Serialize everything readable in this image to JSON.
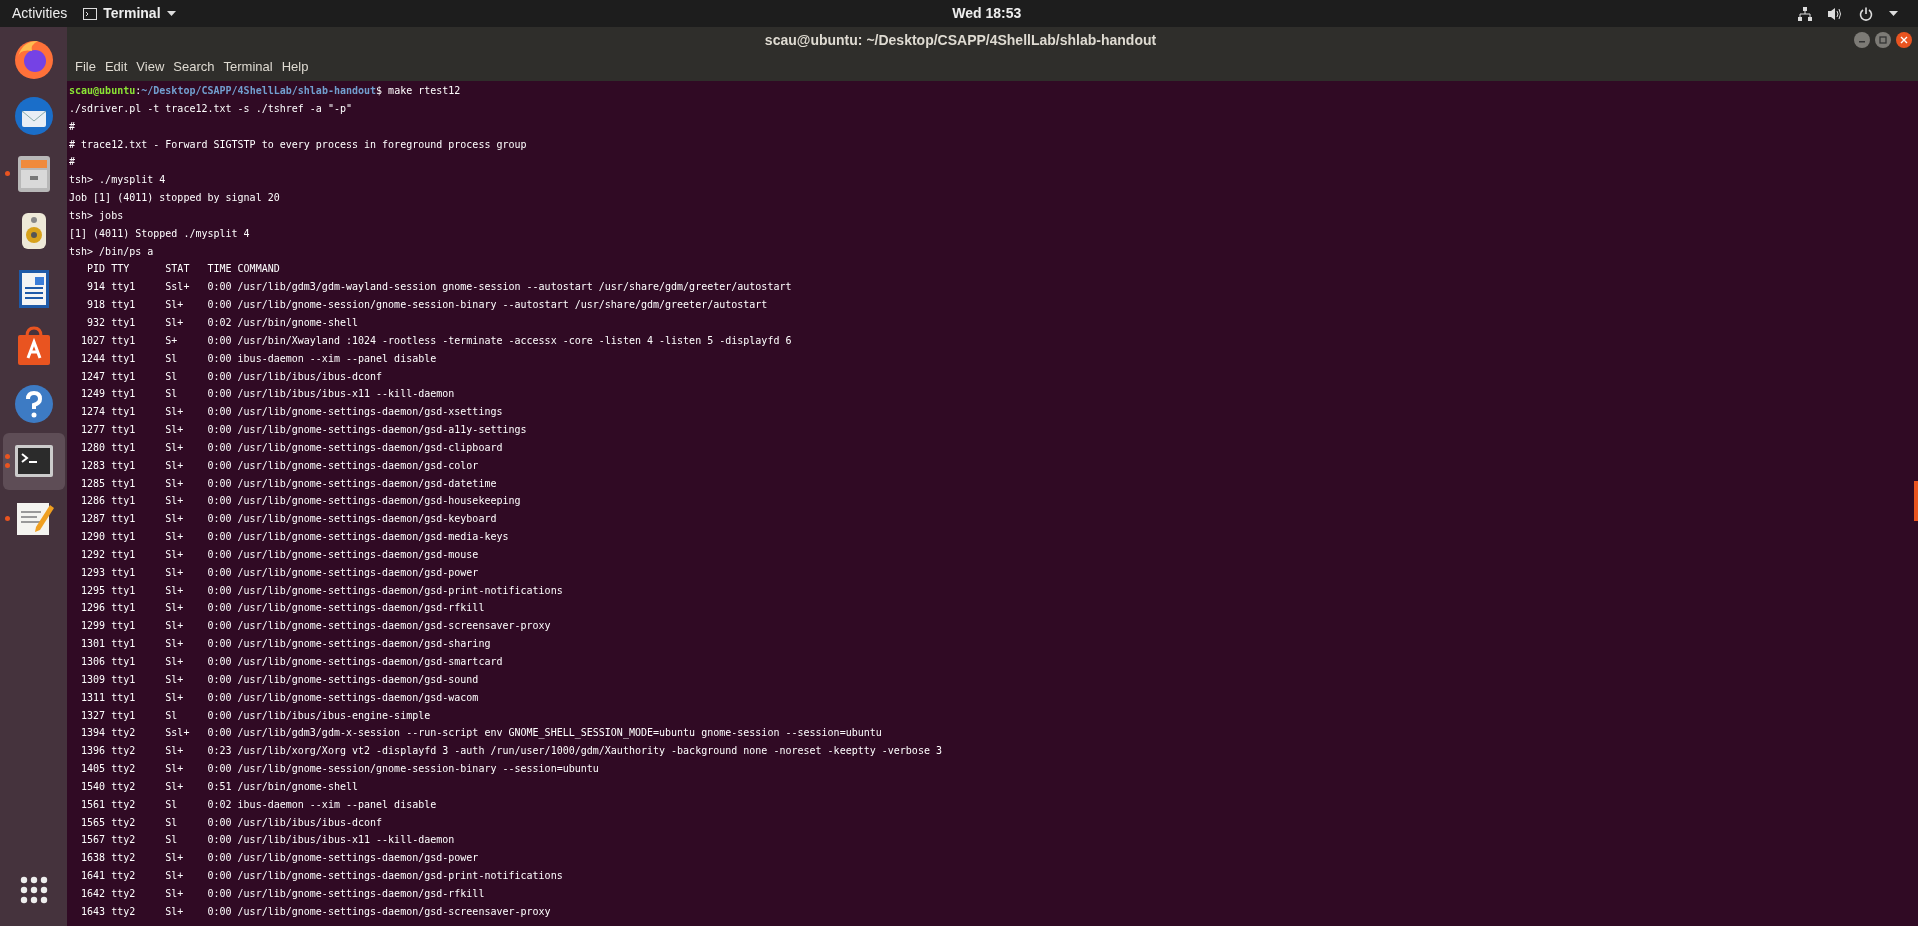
{
  "top_bar": {
    "activities": "Activities",
    "app_menu": "Terminal",
    "clock": "Wed 18:53"
  },
  "dock": {
    "items": [
      {
        "kind": "firefox",
        "running": false,
        "multiple": false,
        "selected": false
      },
      {
        "kind": "thunderbird",
        "running": false,
        "multiple": false,
        "selected": false
      },
      {
        "kind": "files",
        "running": true,
        "multiple": false,
        "selected": false
      },
      {
        "kind": "rhythmbox",
        "running": false,
        "multiple": false,
        "selected": false
      },
      {
        "kind": "writer",
        "running": false,
        "multiple": false,
        "selected": false
      },
      {
        "kind": "software",
        "running": false,
        "multiple": false,
        "selected": false
      },
      {
        "kind": "help",
        "running": false,
        "multiple": false,
        "selected": false
      },
      {
        "kind": "terminal",
        "running": true,
        "multiple": true,
        "selected": true
      },
      {
        "kind": "editor",
        "running": true,
        "multiple": false,
        "selected": false
      }
    ]
  },
  "window": {
    "title": "scau@ubuntu: ~/Desktop/CSAPP/4ShellLab/shlab-handout",
    "menu": [
      "File",
      "Edit",
      "View",
      "Search",
      "Terminal",
      "Help"
    ]
  },
  "terminal": {
    "lines": [
      {
        "kind": "prompt",
        "user_host": "scau@ubuntu",
        "separator": ":",
        "path": "~/Desktop/CSAPP/4ShellLab/shlab-handout",
        "command": "$ make rtest12"
      },
      {
        "kind": "text",
        "text": "./sdriver.pl -t trace12.txt -s ./tshref -a \"-p\""
      },
      {
        "kind": "text",
        "text": "#"
      },
      {
        "kind": "text",
        "text": "# trace12.txt - Forward SIGTSTP to every process in foreground process group"
      },
      {
        "kind": "text",
        "text": "#"
      },
      {
        "kind": "text",
        "text": "tsh> ./mysplit 4"
      },
      {
        "kind": "text",
        "text": "Job [1] (4011) stopped by signal 20"
      },
      {
        "kind": "text",
        "text": "tsh> jobs"
      },
      {
        "kind": "text",
        "text": "[1] (4011) Stopped ./mysplit 4"
      },
      {
        "kind": "text",
        "text": "tsh> /bin/ps a"
      },
      {
        "kind": "text",
        "text": "   PID TTY      STAT   TIME COMMAND"
      },
      {
        "kind": "text",
        "text": "   914 tty1     Ssl+   0:00 /usr/lib/gdm3/gdm-wayland-session gnome-session --autostart /usr/share/gdm/greeter/autostart"
      },
      {
        "kind": "text",
        "text": "   918 tty1     Sl+    0:00 /usr/lib/gnome-session/gnome-session-binary --autostart /usr/share/gdm/greeter/autostart"
      },
      {
        "kind": "text",
        "text": "   932 tty1     Sl+    0:02 /usr/bin/gnome-shell"
      },
      {
        "kind": "text",
        "text": "  1027 tty1     S+     0:00 /usr/bin/Xwayland :1024 -rootless -terminate -accessx -core -listen 4 -listen 5 -displayfd 6"
      },
      {
        "kind": "text",
        "text": "  1244 tty1     Sl     0:00 ibus-daemon --xim --panel disable"
      },
      {
        "kind": "text",
        "text": "  1247 tty1     Sl     0:00 /usr/lib/ibus/ibus-dconf"
      },
      {
        "kind": "text",
        "text": "  1249 tty1     Sl     0:00 /usr/lib/ibus/ibus-x11 --kill-daemon"
      },
      {
        "kind": "text",
        "text": "  1274 tty1     Sl+    0:00 /usr/lib/gnome-settings-daemon/gsd-xsettings"
      },
      {
        "kind": "text",
        "text": "  1277 tty1     Sl+    0:00 /usr/lib/gnome-settings-daemon/gsd-a11y-settings"
      },
      {
        "kind": "text",
        "text": "  1280 tty1     Sl+    0:00 /usr/lib/gnome-settings-daemon/gsd-clipboard"
      },
      {
        "kind": "text",
        "text": "  1283 tty1     Sl+    0:00 /usr/lib/gnome-settings-daemon/gsd-color"
      },
      {
        "kind": "text",
        "text": "  1285 tty1     Sl+    0:00 /usr/lib/gnome-settings-daemon/gsd-datetime"
      },
      {
        "kind": "text",
        "text": "  1286 tty1     Sl+    0:00 /usr/lib/gnome-settings-daemon/gsd-housekeeping"
      },
      {
        "kind": "text",
        "text": "  1287 tty1     Sl+    0:00 /usr/lib/gnome-settings-daemon/gsd-keyboard"
      },
      {
        "kind": "text",
        "text": "  1290 tty1     Sl+    0:00 /usr/lib/gnome-settings-daemon/gsd-media-keys"
      },
      {
        "kind": "text",
        "text": "  1292 tty1     Sl+    0:00 /usr/lib/gnome-settings-daemon/gsd-mouse"
      },
      {
        "kind": "text",
        "text": "  1293 tty1     Sl+    0:00 /usr/lib/gnome-settings-daemon/gsd-power"
      },
      {
        "kind": "text",
        "text": "  1295 tty1     Sl+    0:00 /usr/lib/gnome-settings-daemon/gsd-print-notifications"
      },
      {
        "kind": "text",
        "text": "  1296 tty1     Sl+    0:00 /usr/lib/gnome-settings-daemon/gsd-rfkill"
      },
      {
        "kind": "text",
        "text": "  1299 tty1     Sl+    0:00 /usr/lib/gnome-settings-daemon/gsd-screensaver-proxy"
      },
      {
        "kind": "text",
        "text": "  1301 tty1     Sl+    0:00 /usr/lib/gnome-settings-daemon/gsd-sharing"
      },
      {
        "kind": "text",
        "text": "  1306 tty1     Sl+    0:00 /usr/lib/gnome-settings-daemon/gsd-smartcard"
      },
      {
        "kind": "text",
        "text": "  1309 tty1     Sl+    0:00 /usr/lib/gnome-settings-daemon/gsd-sound"
      },
      {
        "kind": "text",
        "text": "  1311 tty1     Sl+    0:00 /usr/lib/gnome-settings-daemon/gsd-wacom"
      },
      {
        "kind": "text",
        "text": "  1327 tty1     Sl     0:00 /usr/lib/ibus/ibus-engine-simple"
      },
      {
        "kind": "text",
        "text": "  1394 tty2     Ssl+   0:00 /usr/lib/gdm3/gdm-x-session --run-script env GNOME_SHELL_SESSION_MODE=ubuntu gnome-session --session=ubuntu"
      },
      {
        "kind": "text",
        "text": "  1396 tty2     Sl+    0:23 /usr/lib/xorg/Xorg vt2 -displayfd 3 -auth /run/user/1000/gdm/Xauthority -background none -noreset -keeptty -verbose 3"
      },
      {
        "kind": "text",
        "text": "  1405 tty2     Sl+    0:00 /usr/lib/gnome-session/gnome-session-binary --session=ubuntu"
      },
      {
        "kind": "text",
        "text": "  1540 tty2     Sl+    0:51 /usr/bin/gnome-shell"
      },
      {
        "kind": "text",
        "text": "  1561 tty2     Sl     0:02 ibus-daemon --xim --panel disable"
      },
      {
        "kind": "text",
        "text": "  1565 tty2     Sl     0:00 /usr/lib/ibus/ibus-dconf"
      },
      {
        "kind": "text",
        "text": "  1567 tty2     Sl     0:00 /usr/lib/ibus/ibus-x11 --kill-daemon"
      },
      {
        "kind": "text",
        "text": "  1638 tty2     Sl+    0:00 /usr/lib/gnome-settings-daemon/gsd-power"
      },
      {
        "kind": "text",
        "text": "  1641 tty2     Sl+    0:00 /usr/lib/gnome-settings-daemon/gsd-print-notifications"
      },
      {
        "kind": "text",
        "text": "  1642 tty2     Sl+    0:00 /usr/lib/gnome-settings-daemon/gsd-rfkill"
      },
      {
        "kind": "text",
        "text": "  1643 tty2     Sl+    0:00 /usr/lib/gnome-settings-daemon/gsd-screensaver-proxy"
      }
    ]
  }
}
